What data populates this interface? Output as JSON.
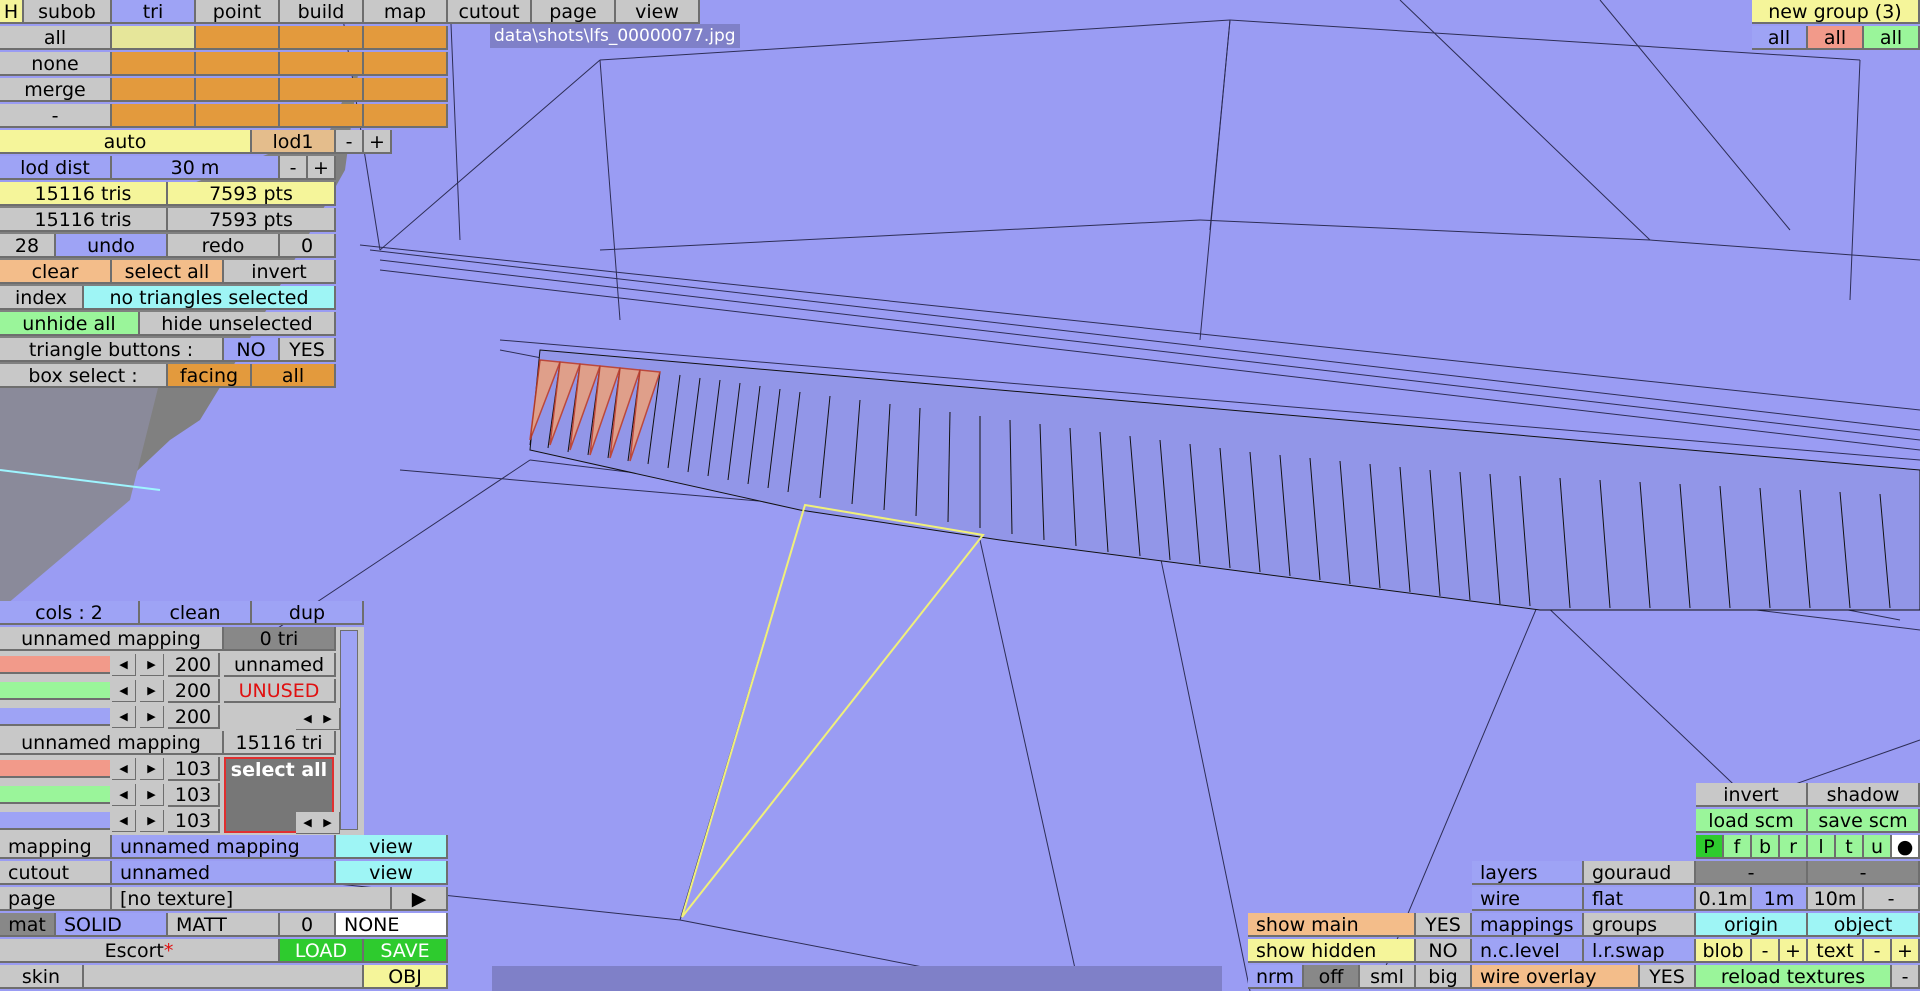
{
  "viewport": {
    "file_path": "data\\shots\\lfs_00000077.jpg"
  },
  "top_tabs": {
    "h": "H",
    "subob": "subob",
    "tri": "tri",
    "point": "point",
    "build": "build",
    "map": "map",
    "cutout": "cutout",
    "page": "page",
    "view": "view"
  },
  "select_panel": {
    "all": "all",
    "none": "none",
    "merge": "merge",
    "dash": "-"
  },
  "lod": {
    "auto": "auto",
    "lod1": "lod1",
    "minus": "-",
    "plus": "+",
    "dist_label": "lod dist",
    "dist_value": "30 m",
    "dist_minus": "-",
    "dist_plus": "+"
  },
  "counts": {
    "tris1": "15116 tris",
    "pts1": "7593 pts",
    "tris2": "15116 tris",
    "pts2": "7593 pts"
  },
  "history": {
    "undo_count": "28",
    "undo": "undo",
    "redo": "redo",
    "redo_count": "0"
  },
  "selection": {
    "clear": "clear",
    "select_all": "select all",
    "invert": "invert",
    "index": "index",
    "status": "no triangles selected",
    "unhide_all": "unhide all",
    "hide_unselected": "hide unselected",
    "tri_buttons_label": "triangle buttons :",
    "no": "NO",
    "yes": "YES",
    "box_select_label": "box select :",
    "facing": "facing",
    "box_all": "all"
  },
  "colours": {
    "cols": "cols : 2",
    "clean": "clean",
    "dup": "dup"
  },
  "mappings": [
    {
      "name": "unnamed mapping",
      "tri": "0 tri",
      "values": [
        "200",
        "200",
        "200"
      ],
      "info_name": "unnamed",
      "info_status": "UNUSED"
    },
    {
      "name": "unnamed mapping",
      "tri": "15116 tri",
      "values": [
        "103",
        "103",
        "103"
      ],
      "action": "select all"
    }
  ],
  "bottom_left": {
    "mapping_label": "mapping",
    "mapping_value": "unnamed mapping",
    "mapping_view": "view",
    "cutout_label": "cutout",
    "cutout_value": "unnamed",
    "cutout_view": "view",
    "page_label": "page",
    "page_value": "[no texture]",
    "page_arrow": "▶",
    "mat": "mat",
    "solid": "SOLID",
    "matt": "MATT",
    "mat_num": "0",
    "none": "NONE",
    "escort": "Escort",
    "escort_mark": "*",
    "load": "LOAD",
    "save": "SAVE",
    "skin": "skin",
    "obj": "OBJ"
  },
  "groups": {
    "new_group": "new group (3)",
    "all1": "all",
    "all2": "all",
    "all3": "all"
  },
  "bottom_right": {
    "invert": "invert",
    "shadow": "shadow",
    "load_scm": "load scm",
    "save_scm": "save scm",
    "letters": [
      "P",
      "f",
      "b",
      "r",
      "l",
      "t",
      "u",
      "●"
    ],
    "dash1": "-",
    "dash2": "-",
    "d01": "0.1m",
    "d1": "1m",
    "d10": "10m",
    "dminus": "-",
    "origin": "origin",
    "object": "object",
    "blob": "blob",
    "blob_minus": "-",
    "blob_plus": "+",
    "text": "text",
    "text_minus": "-",
    "text_plus": "+",
    "reload": "reload textures",
    "reload_minus": "-",
    "layers": "layers",
    "gouraud": "gouraud",
    "wire": "wire",
    "flat": "flat",
    "mappings": "mappings",
    "groups_btn": "groups",
    "nc_level": "n.c.level",
    "lr_swap": "l.r.swap",
    "wire_overlay": "wire overlay",
    "wire_overlay_val": "YES",
    "show_main": "show main",
    "show_main_val": "YES",
    "show_hidden": "show hidden",
    "show_hidden_val": "NO",
    "nrm": "nrm",
    "off": "off",
    "sml": "sml",
    "big": "big"
  }
}
